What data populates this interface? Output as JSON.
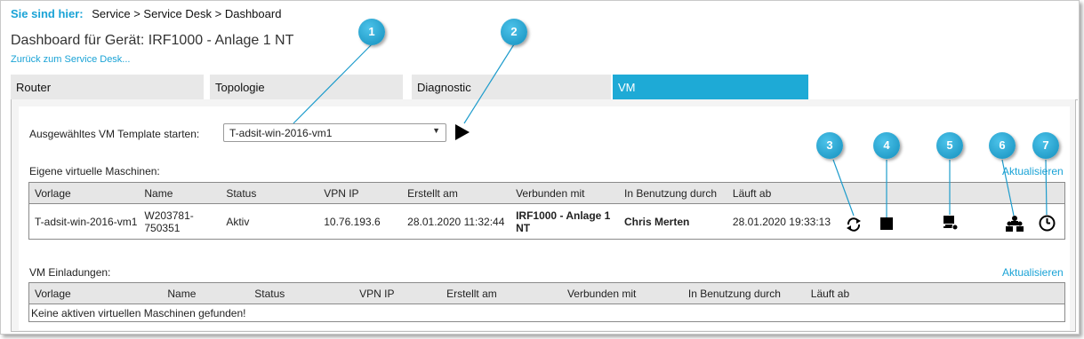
{
  "breadcrumb": {
    "label": "Sie sind hier:",
    "path": "Service > Service Desk > Dashboard"
  },
  "page_title": "Dashboard für Gerät: IRF1000 - Anlage 1 NT",
  "back_link": "Zurück zum Service Desk...",
  "tabs": [
    {
      "label": "Router",
      "active": false
    },
    {
      "label": "Topologie",
      "active": false
    },
    {
      "label": "Diagnostic",
      "active": false
    },
    {
      "label": "VM",
      "active": true
    }
  ],
  "vm_start": {
    "label": "Ausgewähltes VM Template starten:",
    "selected_template": "T-adsit-win-2016-vm1"
  },
  "own_vms": {
    "title": "Eigene virtuelle Maschinen:",
    "refresh_label": "Aktualisieren",
    "columns": [
      "Vorlage",
      "Name",
      "Status",
      "VPN IP",
      "Erstellt am",
      "Verbunden mit",
      "In Benutzung durch",
      "Läuft ab"
    ],
    "rows": [
      {
        "vorlage": "T-adsit-win-2016-vm1",
        "name": "W203781-750351",
        "status": "Aktiv",
        "vpn_ip": "10.76.193.6",
        "erstellt_am": "28.01.2020 11:32:44",
        "verbunden_mit": "IRF1000 - Anlage 1 NT",
        "in_benutzung_durch": "Chris Merten",
        "laeuft_ab": "28.01.2020 19:33:13"
      }
    ]
  },
  "invitations": {
    "title": "VM Einladungen:",
    "refresh_label": "Aktualisieren",
    "columns": [
      "Vorlage",
      "Name",
      "Status",
      "VPN IP",
      "Erstellt am",
      "Verbunden mit",
      "In Benutzung durch",
      "Läuft ab"
    ],
    "empty_message": "Keine aktiven virtuellen Maschinen gefunden!"
  },
  "callouts": [
    "1",
    "2",
    "3",
    "4",
    "5",
    "6",
    "7"
  ],
  "icons": [
    "restart-icon",
    "stop-icon",
    "remote-console-icon",
    "users-icon",
    "clock-icon"
  ],
  "colors": {
    "accent": "#1eaad6",
    "link": "#1aa3d6",
    "tab_bg": "#e8e8e8"
  }
}
